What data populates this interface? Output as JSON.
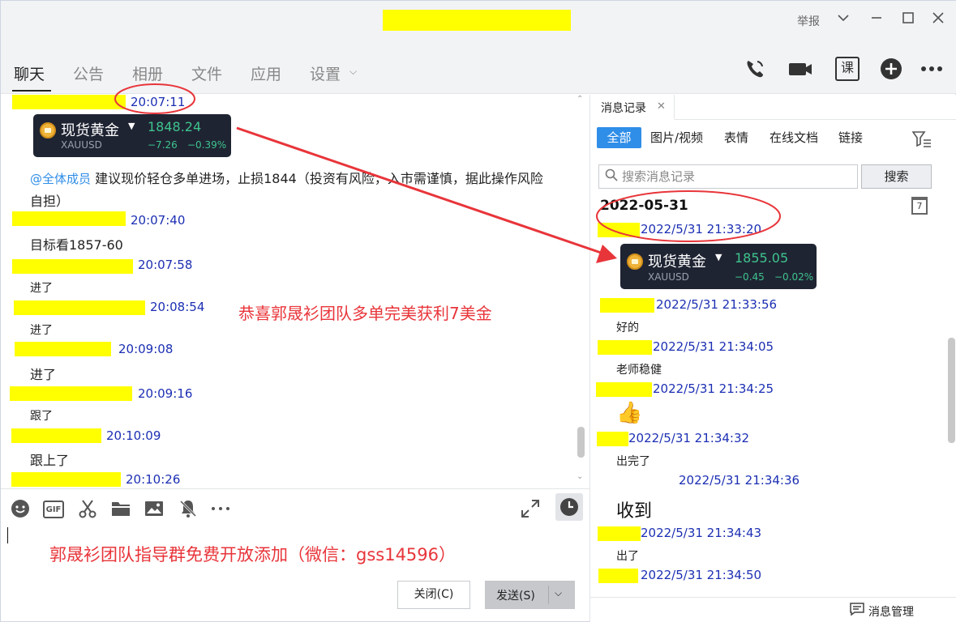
{
  "titlebar": {
    "report_label": "举报",
    "icons": [
      "chevron-down-icon",
      "minimize-icon",
      "maximize-icon",
      "close-icon"
    ]
  },
  "tabs": [
    {
      "label": "聊天",
      "active": true
    },
    {
      "label": "公告"
    },
    {
      "label": "相册"
    },
    {
      "label": "文件"
    },
    {
      "label": "应用"
    },
    {
      "label": "设置"
    }
  ],
  "toolbar": {
    "course_label": "课",
    "icons": [
      "phone-icon",
      "video-icon",
      "course-icon",
      "add-icon",
      "more-icon"
    ]
  },
  "chat": {
    "messages": [
      {
        "time": "20:07:11",
        "card": {
          "name": "现货黄金",
          "symbol": "XAUUSD",
          "price": "1848.24",
          "change": "−7.26",
          "percent": "−0.39%"
        }
      },
      {
        "mention": "@全体成员",
        "text_line1": "建议现价轻仓多单进场，止损1844（投资有风险，入市需谨慎，据此操作风险",
        "text_line2": "自担）"
      },
      {
        "time": "20:07:40",
        "text": "目标看1857-60"
      },
      {
        "time": "20:07:58",
        "text": "进了"
      },
      {
        "time": "20:08:54",
        "text": "进了"
      },
      {
        "time": "20:09:08",
        "text": "进了"
      },
      {
        "time": "20:09:16",
        "text": "跟了"
      },
      {
        "time": "20:10:09",
        "text": "跟上了"
      },
      {
        "time": "20:10:26"
      }
    ],
    "annotation": "恭喜郭晟衫团队多单完美获利7美金"
  },
  "input": {
    "icons": [
      "emoji-icon",
      "gif-icon",
      "scissors-icon",
      "folder-icon",
      "image-icon",
      "mute-bell-icon",
      "more-icon",
      "expand-icon",
      "clock-icon"
    ],
    "gif_label": "GIF",
    "text": "郭晟衫团队指导群免费开放添加（微信：gss14596）",
    "close_label": "关闭(C)",
    "send_label": "发送(S)"
  },
  "history": {
    "tab_label": "消息记录",
    "filters": [
      "全部",
      "图片/视频",
      "表情",
      "在线文档",
      "链接"
    ],
    "search_placeholder": "搜索消息记录",
    "search_button": "搜索",
    "date_heading": "2022-05-31",
    "calendar_day": "7",
    "entries": [
      {
        "time": "2022/5/31 21:33:20",
        "card": {
          "name": "现货黄金",
          "symbol": "XAUUSD",
          "price": "1855.05",
          "change": "−0.45",
          "percent": "−0.02%"
        }
      },
      {
        "time": "2022/5/31 21:33:56",
        "text": "好的"
      },
      {
        "time": "2022/5/31 21:34:05",
        "text": "老师稳健"
      },
      {
        "time": "2022/5/31 21:34:25",
        "emoji": "👍"
      },
      {
        "time": "2022/5/31 21:34:32",
        "text": "出完了"
      },
      {
        "time": "2022/5/31 21:34:36",
        "big": "收到"
      },
      {
        "time": "2022/5/31 21:34:43",
        "text": "出了"
      },
      {
        "time": "2022/5/31 21:34:50"
      }
    ],
    "footer_label": "消息管理"
  },
  "colors": {
    "redaction": "#ffff00",
    "annotation": "#e8353a",
    "timestamp": "#1c2fb3",
    "accent": "#2f8ee8",
    "gain": "#3ec48d",
    "card_bg": "#1f2433"
  }
}
